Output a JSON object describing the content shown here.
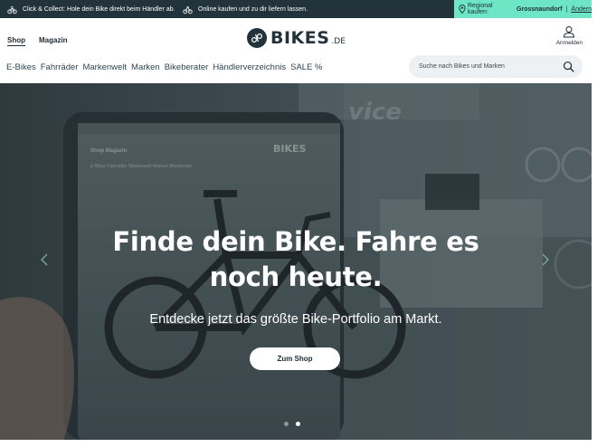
{
  "topbar": {
    "click_collect": "Click & Collect: Hole dein Bike direkt beim Händler ab.",
    "online": "Online kaufen und zu dir liefern lassen.",
    "region_label": "Regional kaufen:",
    "region_value": "Grossnaundorf",
    "change_link": "Ändern"
  },
  "header": {
    "tabs": [
      {
        "label": "Shop",
        "active": true
      },
      {
        "label": "Magazin",
        "active": false
      }
    ],
    "logo_text": "BIKES",
    "logo_tld": ".DE",
    "login_label": "Anmelden"
  },
  "nav": {
    "items": [
      "E-Bikes",
      "Fahrräder",
      "Markenwelt",
      "Marken",
      "Bikeberater",
      "Händlerverzeichnis",
      "SALE %"
    ]
  },
  "search": {
    "placeholder": "Suche nach Bikes und Marken"
  },
  "hero": {
    "title_line1": "Finde dein Bike. Fahre es",
    "title_line2": "noch heute.",
    "subtitle": "Entdecke jetzt das größte Bike-Portfolio am Markt.",
    "cta": "Zum Shop",
    "slides_total": 2,
    "slide_active": 2
  },
  "icons": {
    "click_collect": "bike-dealer-icon",
    "online": "bike-icon",
    "region": "location-pin-icon",
    "login": "user-icon",
    "search": "search-icon",
    "prev": "chevron-left-icon",
    "next": "chevron-right-icon"
  },
  "colors": {
    "topbar_bg": "#23333c",
    "region_bg": "#6ee6c5",
    "text_dark": "#1c2b33",
    "search_bg": "#eef1f3"
  }
}
